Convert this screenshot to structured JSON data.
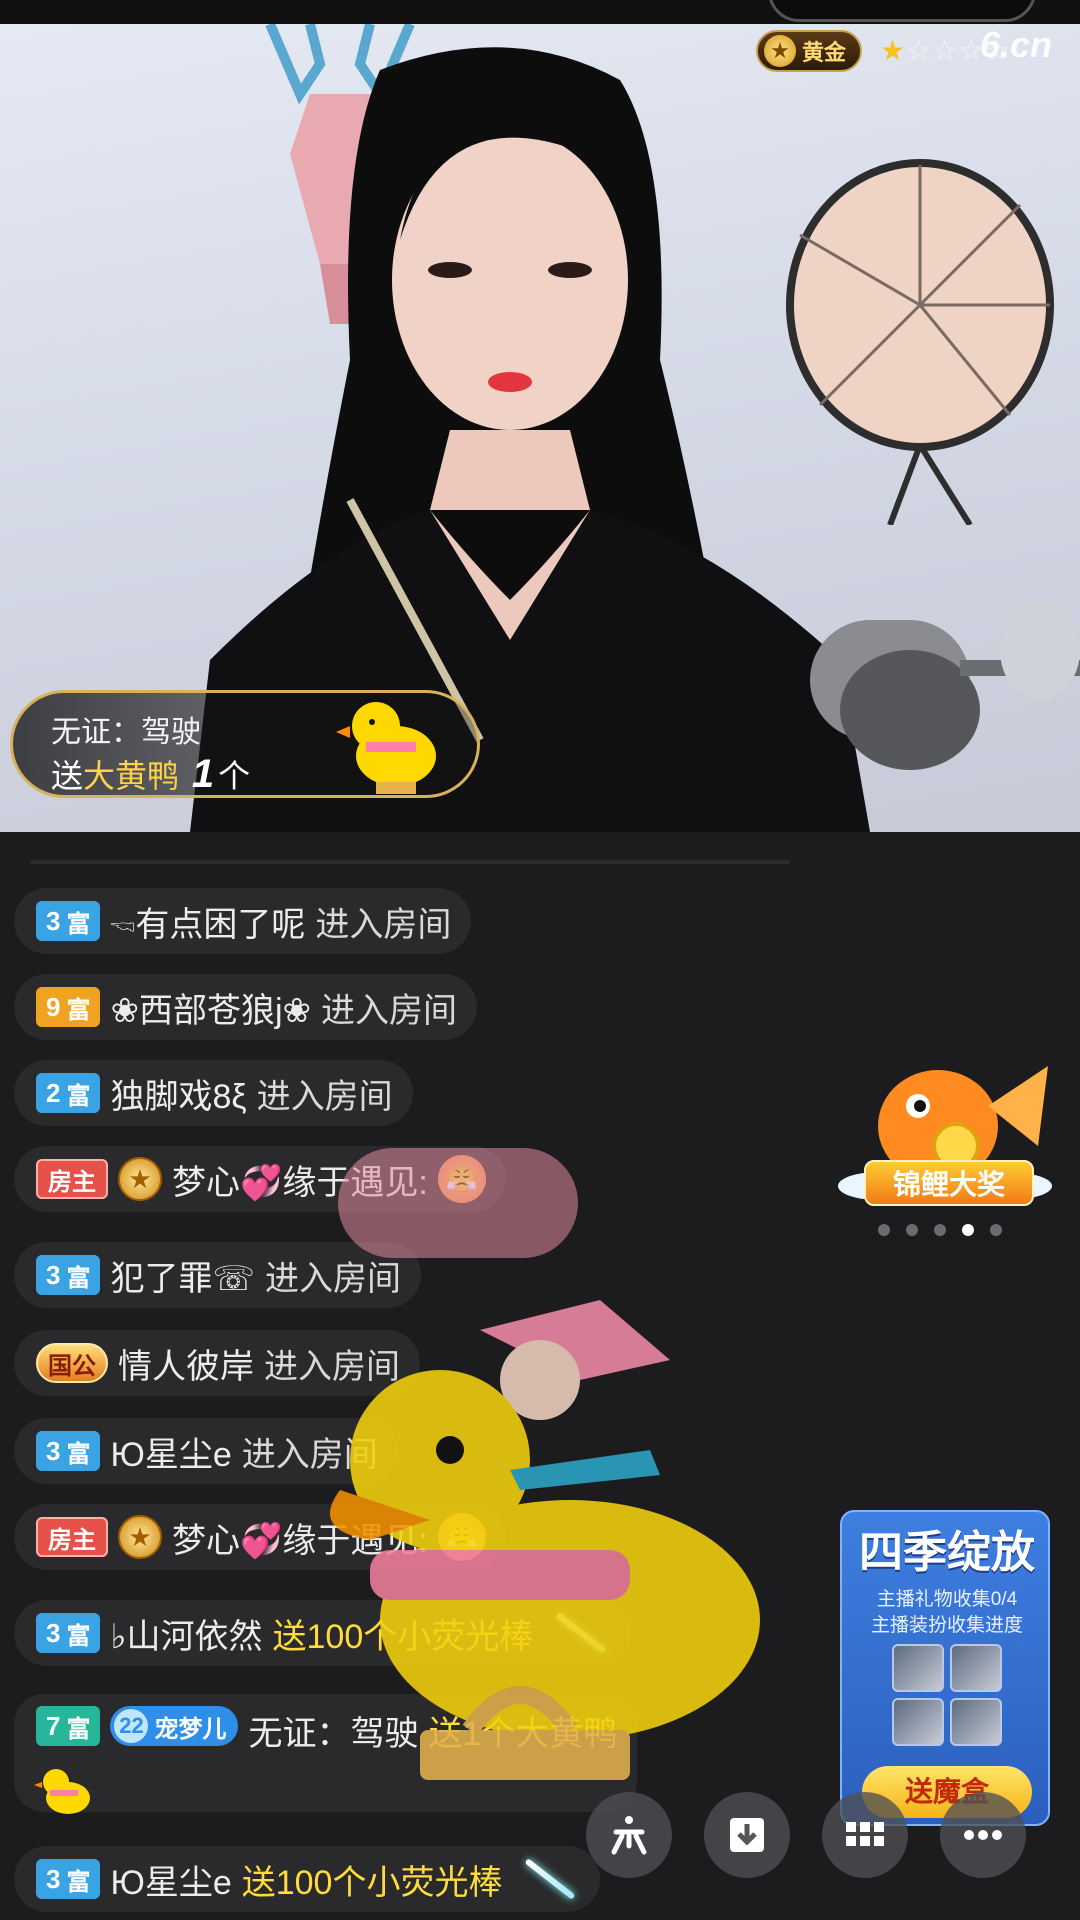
{
  "overlay": {
    "level_text": "黄金",
    "stars_on": "★",
    "stars_off": "☆☆☆☆",
    "watermark": "6.cn"
  },
  "gift_toast": {
    "user": "无证：驾驶",
    "send_word": "送",
    "gift_name": "大黄鸭",
    "count": "1",
    "unit": "个"
  },
  "chat": [
    {
      "tag_num": "3",
      "tag_label": "富",
      "text": "🖘有点困了呢",
      "action": "进入房间"
    },
    {
      "tag_num": "9",
      "tag_label": "富",
      "text": "❀西部苍狼j❀",
      "action": "进入房间"
    },
    {
      "tag_num": "2",
      "tag_label": "富",
      "text": "独脚戏8ξ",
      "action": "进入房间"
    },
    {
      "tag_label": "房主",
      "text": "梦心💞缘于遇见:",
      "emoji": "😤"
    },
    {
      "tag_num": "3",
      "tag_label": "富",
      "text": "犯了罪☏",
      "action": "进入房间"
    },
    {
      "tag_label": "国公",
      "text": "情人彼岸",
      "action": "进入房间"
    },
    {
      "tag_num": "3",
      "tag_label": "富",
      "text": "Ю星尘e",
      "action": "进入房间"
    },
    {
      "tag_label": "房主",
      "text": "梦心💞缘于遇见:",
      "emoji": "😤"
    },
    {
      "tag_num": "3",
      "tag_label": "富",
      "text": "♭山河依然",
      "gift": "送100个小荧光棒"
    },
    {
      "tag_num": "7",
      "tag_label": "富",
      "pet": "宠梦儿",
      "pet_num": "22",
      "text": "无证：驾驶",
      "gift": "送1个大黄鸭"
    },
    {
      "tag_num": "3",
      "tag_label": "富",
      "text": "Ю星尘e",
      "gift": "送100个小荧光棒"
    }
  ],
  "side": {
    "koi_label": "锦鲤大奖",
    "carousel_count": 5,
    "carousel_active": 4,
    "season_title": "四季绽放",
    "season_line1": "主播礼物收集0/4",
    "season_line2": "主播装扮收集进度",
    "season_button": "送魔盒"
  },
  "colors": {
    "accent_gold": "#d9b15a",
    "gift_yellow": "#ffdc3c",
    "tag_blue": "#3aa3e3"
  }
}
